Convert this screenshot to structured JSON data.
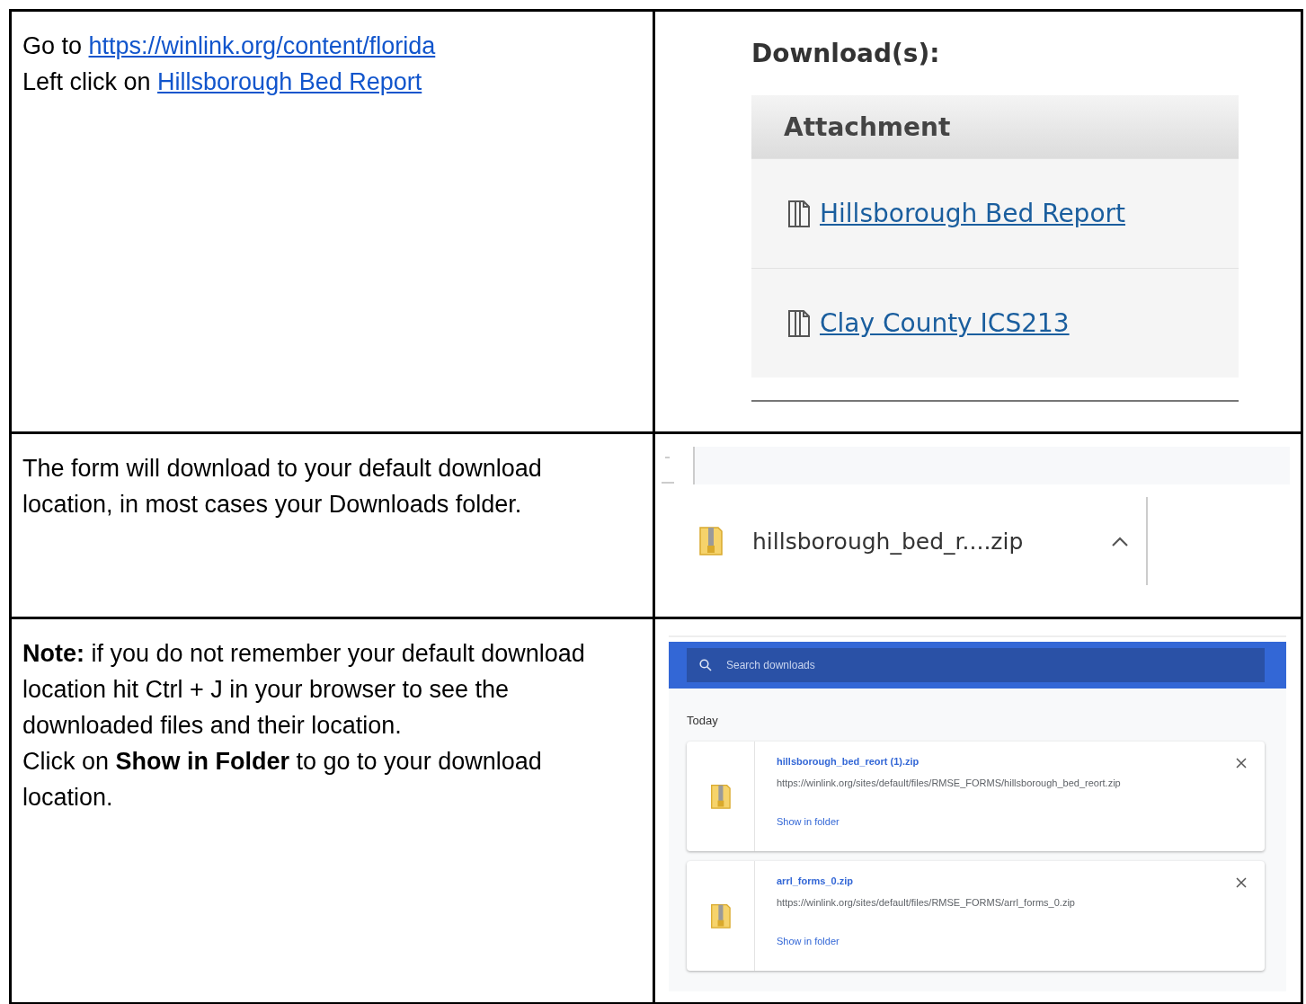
{
  "rows": [
    {
      "lines": [
        [
          {
            "kind": "text",
            "text": "Go to "
          },
          {
            "kind": "link",
            "text": "https://winlink.org/content/florida"
          }
        ],
        [
          {
            "kind": "text",
            "text": "Left click on "
          },
          {
            "kind": "link",
            "text": "Hillsborough Bed Report"
          }
        ]
      ],
      "screenshot": {
        "kind": "attachments",
        "heading": "Download(s):",
        "column": "Attachment",
        "files": [
          "Hillsborough Bed Report",
          "Clay County ICS213"
        ]
      }
    },
    {
      "lines": [
        [
          {
            "kind": "text",
            "text": "The form will download to your default download location, in most cases your Downloads folder."
          }
        ]
      ],
      "screenshot": {
        "kind": "shelf",
        "file": "hillsborough_bed_r....zip"
      }
    },
    {
      "lines": [
        [
          {
            "kind": "text",
            "text": " **Note:** if you do not remember your default download location hit Ctrl + J in your browser to see the downloaded files and their location."
          }
        ],
        [
          {
            "kind": "text",
            "text": "Click on **Show in Folder** to go to your download location."
          }
        ]
      ],
      "screenshot": {
        "kind": "downloads",
        "search": {
          "placeholder": "Search downloads"
        },
        "day": "Today",
        "items": [
          {
            "name": "hillsborough_bed_reort (1).zip",
            "url": "https://winlink.org/sites/default/files/RMSE_FORMS/hillsborough_bed_reort.zip",
            "action": "Show in folder"
          },
          {
            "name": "arrl_forms_0.zip",
            "url": "https://winlink.org/sites/default/files/RMSE_FORMS/arrl_forms_0.zip",
            "action": "Show in folder"
          }
        ]
      }
    }
  ]
}
